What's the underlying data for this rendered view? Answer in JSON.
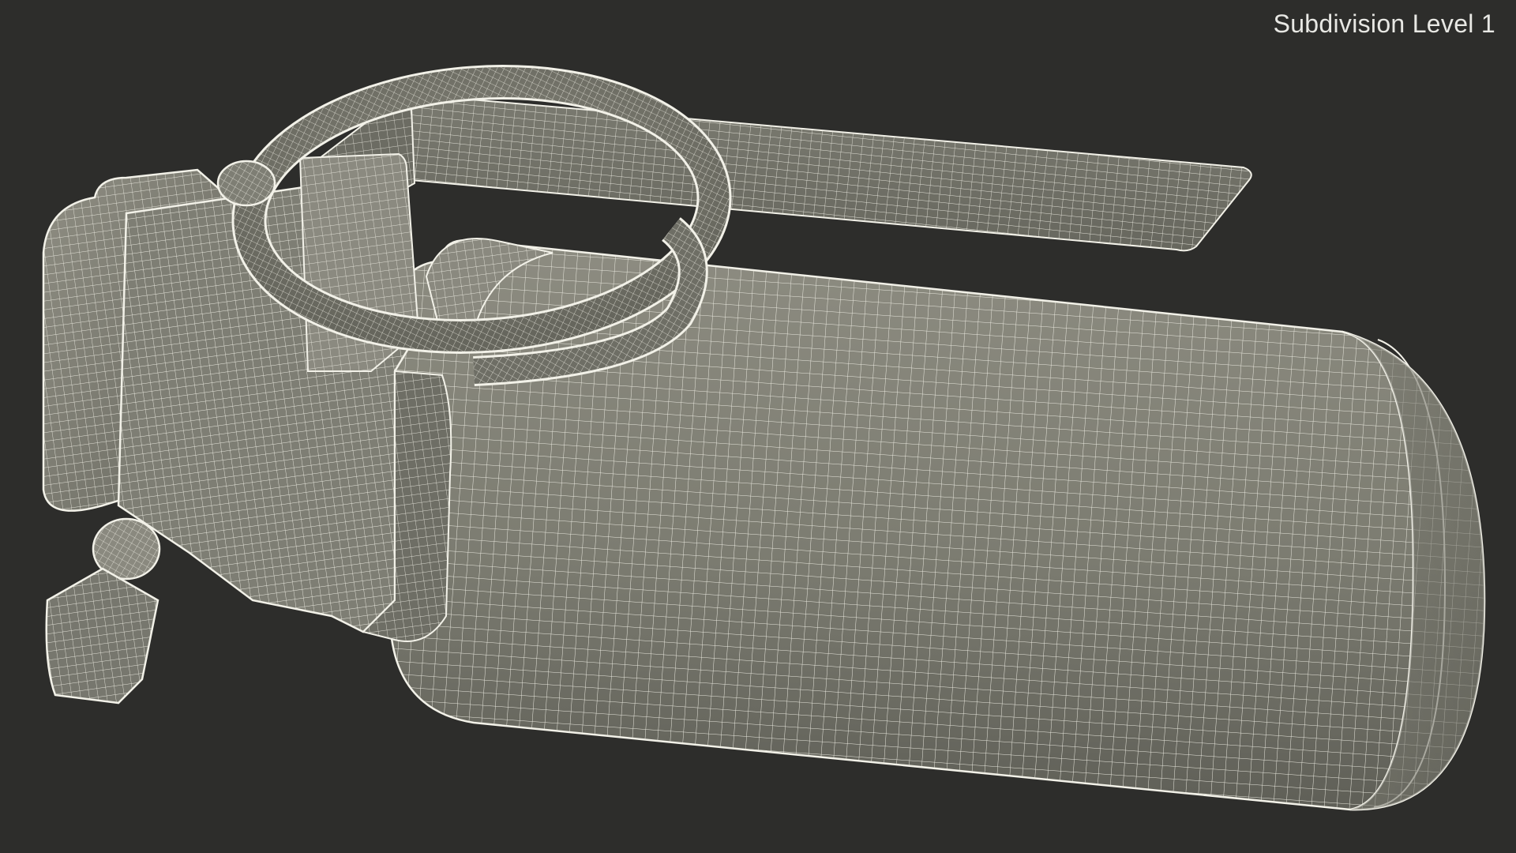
{
  "viewport": {
    "label": "Subdivision Level 1"
  },
  "render": {
    "subject": "grenade-wireframe",
    "wire_color": "#f2f1e8",
    "shade_light": "#8c8b80",
    "shade_mid": "#7a7a6f",
    "shade_dark": "#56564e",
    "background": "#2d2d2b"
  }
}
